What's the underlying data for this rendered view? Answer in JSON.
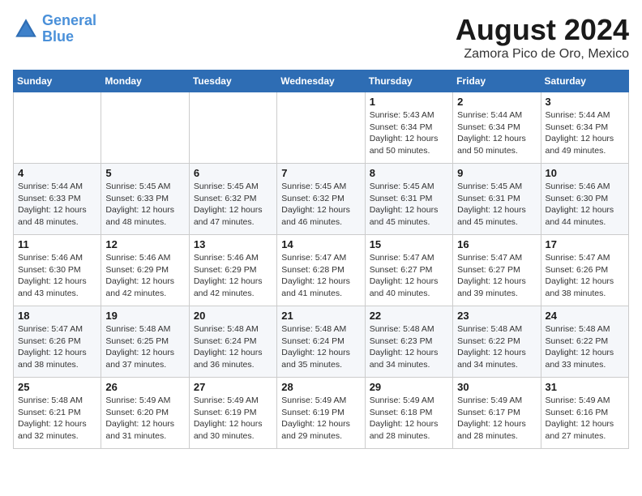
{
  "header": {
    "logo_line1": "General",
    "logo_line2": "Blue",
    "month_title": "August 2024",
    "location": "Zamora Pico de Oro, Mexico"
  },
  "days_of_week": [
    "Sunday",
    "Monday",
    "Tuesday",
    "Wednesday",
    "Thursday",
    "Friday",
    "Saturday"
  ],
  "weeks": [
    [
      {
        "day": "",
        "info": ""
      },
      {
        "day": "",
        "info": ""
      },
      {
        "day": "",
        "info": ""
      },
      {
        "day": "",
        "info": ""
      },
      {
        "day": "1",
        "info": "Sunrise: 5:43 AM\nSunset: 6:34 PM\nDaylight: 12 hours and 50 minutes."
      },
      {
        "day": "2",
        "info": "Sunrise: 5:44 AM\nSunset: 6:34 PM\nDaylight: 12 hours and 50 minutes."
      },
      {
        "day": "3",
        "info": "Sunrise: 5:44 AM\nSunset: 6:34 PM\nDaylight: 12 hours and 49 minutes."
      }
    ],
    [
      {
        "day": "4",
        "info": "Sunrise: 5:44 AM\nSunset: 6:33 PM\nDaylight: 12 hours and 48 minutes."
      },
      {
        "day": "5",
        "info": "Sunrise: 5:45 AM\nSunset: 6:33 PM\nDaylight: 12 hours and 48 minutes."
      },
      {
        "day": "6",
        "info": "Sunrise: 5:45 AM\nSunset: 6:32 PM\nDaylight: 12 hours and 47 minutes."
      },
      {
        "day": "7",
        "info": "Sunrise: 5:45 AM\nSunset: 6:32 PM\nDaylight: 12 hours and 46 minutes."
      },
      {
        "day": "8",
        "info": "Sunrise: 5:45 AM\nSunset: 6:31 PM\nDaylight: 12 hours and 45 minutes."
      },
      {
        "day": "9",
        "info": "Sunrise: 5:45 AM\nSunset: 6:31 PM\nDaylight: 12 hours and 45 minutes."
      },
      {
        "day": "10",
        "info": "Sunrise: 5:46 AM\nSunset: 6:30 PM\nDaylight: 12 hours and 44 minutes."
      }
    ],
    [
      {
        "day": "11",
        "info": "Sunrise: 5:46 AM\nSunset: 6:30 PM\nDaylight: 12 hours and 43 minutes."
      },
      {
        "day": "12",
        "info": "Sunrise: 5:46 AM\nSunset: 6:29 PM\nDaylight: 12 hours and 42 minutes."
      },
      {
        "day": "13",
        "info": "Sunrise: 5:46 AM\nSunset: 6:29 PM\nDaylight: 12 hours and 42 minutes."
      },
      {
        "day": "14",
        "info": "Sunrise: 5:47 AM\nSunset: 6:28 PM\nDaylight: 12 hours and 41 minutes."
      },
      {
        "day": "15",
        "info": "Sunrise: 5:47 AM\nSunset: 6:27 PM\nDaylight: 12 hours and 40 minutes."
      },
      {
        "day": "16",
        "info": "Sunrise: 5:47 AM\nSunset: 6:27 PM\nDaylight: 12 hours and 39 minutes."
      },
      {
        "day": "17",
        "info": "Sunrise: 5:47 AM\nSunset: 6:26 PM\nDaylight: 12 hours and 38 minutes."
      }
    ],
    [
      {
        "day": "18",
        "info": "Sunrise: 5:47 AM\nSunset: 6:26 PM\nDaylight: 12 hours and 38 minutes."
      },
      {
        "day": "19",
        "info": "Sunrise: 5:48 AM\nSunset: 6:25 PM\nDaylight: 12 hours and 37 minutes."
      },
      {
        "day": "20",
        "info": "Sunrise: 5:48 AM\nSunset: 6:24 PM\nDaylight: 12 hours and 36 minutes."
      },
      {
        "day": "21",
        "info": "Sunrise: 5:48 AM\nSunset: 6:24 PM\nDaylight: 12 hours and 35 minutes."
      },
      {
        "day": "22",
        "info": "Sunrise: 5:48 AM\nSunset: 6:23 PM\nDaylight: 12 hours and 34 minutes."
      },
      {
        "day": "23",
        "info": "Sunrise: 5:48 AM\nSunset: 6:22 PM\nDaylight: 12 hours and 34 minutes."
      },
      {
        "day": "24",
        "info": "Sunrise: 5:48 AM\nSunset: 6:22 PM\nDaylight: 12 hours and 33 minutes."
      }
    ],
    [
      {
        "day": "25",
        "info": "Sunrise: 5:48 AM\nSunset: 6:21 PM\nDaylight: 12 hours and 32 minutes."
      },
      {
        "day": "26",
        "info": "Sunrise: 5:49 AM\nSunset: 6:20 PM\nDaylight: 12 hours and 31 minutes."
      },
      {
        "day": "27",
        "info": "Sunrise: 5:49 AM\nSunset: 6:19 PM\nDaylight: 12 hours and 30 minutes."
      },
      {
        "day": "28",
        "info": "Sunrise: 5:49 AM\nSunset: 6:19 PM\nDaylight: 12 hours and 29 minutes."
      },
      {
        "day": "29",
        "info": "Sunrise: 5:49 AM\nSunset: 6:18 PM\nDaylight: 12 hours and 28 minutes."
      },
      {
        "day": "30",
        "info": "Sunrise: 5:49 AM\nSunset: 6:17 PM\nDaylight: 12 hours and 28 minutes."
      },
      {
        "day": "31",
        "info": "Sunrise: 5:49 AM\nSunset: 6:16 PM\nDaylight: 12 hours and 27 minutes."
      }
    ]
  ]
}
